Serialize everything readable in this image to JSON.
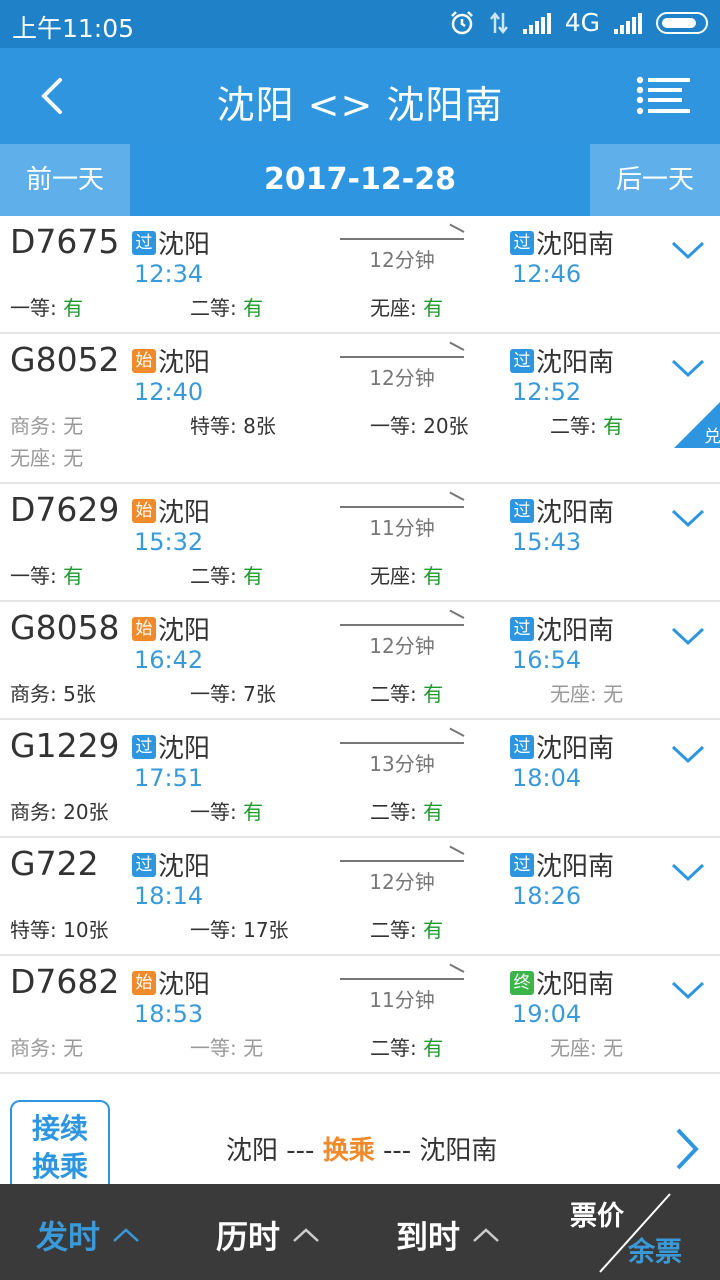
{
  "status": {
    "time": "上午11:05",
    "network": "4G"
  },
  "nav": {
    "title": "沈阳 <> 沈阳南"
  },
  "datebar": {
    "prev": "前一天",
    "date": "2017-12-28",
    "next": "后一天"
  },
  "trains": [
    {
      "no": "D7675",
      "from_tag": "过",
      "from_tag_type": "pass",
      "from": "沈阳",
      "dep": "12:34",
      "duration": "12分钟",
      "to_tag": "过",
      "to_tag_type": "pass",
      "to": "沈阳南",
      "arr": "12:46",
      "seat_rows": [
        [
          {
            "label": "一等: ",
            "value": "有",
            "green": true
          },
          {
            "label": "二等: ",
            "value": "有",
            "green": true
          },
          {
            "label": "无座: ",
            "value": "有",
            "green": true
          }
        ]
      ]
    },
    {
      "no": "G8052",
      "from_tag": "始",
      "from_tag_type": "start",
      "from": "沈阳",
      "dep": "12:40",
      "duration": "12分钟",
      "to_tag": "过",
      "to_tag_type": "pass",
      "to": "沈阳南",
      "arr": "12:52",
      "corner": "兑",
      "seat_rows": [
        [
          {
            "label": "商务: ",
            "value": "无",
            "muted": true
          },
          {
            "label": "特等: ",
            "value": "8张"
          },
          {
            "label": "一等: ",
            "value": "20张"
          },
          {
            "label": "二等: ",
            "value": "有",
            "green": true
          }
        ],
        [
          {
            "label": "无座: ",
            "value": "无",
            "muted": true
          }
        ]
      ]
    },
    {
      "no": "D7629",
      "from_tag": "始",
      "from_tag_type": "start",
      "from": "沈阳",
      "dep": "15:32",
      "duration": "11分钟",
      "to_tag": "过",
      "to_tag_type": "pass",
      "to": "沈阳南",
      "arr": "15:43",
      "seat_rows": [
        [
          {
            "label": "一等: ",
            "value": "有",
            "green": true
          },
          {
            "label": "二等: ",
            "value": "有",
            "green": true
          },
          {
            "label": "无座: ",
            "value": "有",
            "green": true
          }
        ]
      ]
    },
    {
      "no": "G8058",
      "from_tag": "始",
      "from_tag_type": "start",
      "from": "沈阳",
      "dep": "16:42",
      "duration": "12分钟",
      "to_tag": "过",
      "to_tag_type": "pass",
      "to": "沈阳南",
      "arr": "16:54",
      "seat_rows": [
        [
          {
            "label": "商务: ",
            "value": "5张"
          },
          {
            "label": "一等: ",
            "value": "7张"
          },
          {
            "label": "二等: ",
            "value": "有",
            "green": true
          },
          {
            "label": "无座: ",
            "value": "无",
            "muted": true
          }
        ]
      ]
    },
    {
      "no": "G1229",
      "from_tag": "过",
      "from_tag_type": "pass",
      "from": "沈阳",
      "dep": "17:51",
      "duration": "13分钟",
      "to_tag": "过",
      "to_tag_type": "pass",
      "to": "沈阳南",
      "arr": "18:04",
      "seat_rows": [
        [
          {
            "label": "商务: ",
            "value": "20张"
          },
          {
            "label": "一等: ",
            "value": "有",
            "green": true
          },
          {
            "label": "二等: ",
            "value": "有",
            "green": true
          }
        ]
      ]
    },
    {
      "no": "G722",
      "from_tag": "过",
      "from_tag_type": "pass",
      "from": "沈阳",
      "dep": "18:14",
      "duration": "12分钟",
      "to_tag": "过",
      "to_tag_type": "pass",
      "to": "沈阳南",
      "arr": "18:26",
      "seat_rows": [
        [
          {
            "label": "特等: ",
            "value": "10张"
          },
          {
            "label": "一等: ",
            "value": "17张"
          },
          {
            "label": "二等: ",
            "value": "有",
            "green": true
          }
        ]
      ]
    },
    {
      "no": "D7682",
      "from_tag": "始",
      "from_tag_type": "start",
      "from": "沈阳",
      "dep": "18:53",
      "duration": "11分钟",
      "to_tag": "终",
      "to_tag_type": "end",
      "to": "沈阳南",
      "arr": "19:04",
      "seat_rows": [
        [
          {
            "label": "商务: ",
            "value": "无",
            "muted": true
          },
          {
            "label": "一等: ",
            "value": "无",
            "muted": true
          },
          {
            "label": "二等: ",
            "value": "有",
            "green": true
          },
          {
            "label": "无座: ",
            "value": "无",
            "muted": true
          }
        ]
      ]
    }
  ],
  "transfer": {
    "badge_line1": "接续",
    "badge_line2": "换乘",
    "from": "沈阳 --- ",
    "mid": "换乘",
    "to": " --- 沈阳南"
  },
  "bottom": {
    "sort_dep": "发时",
    "sort_dur": "历时",
    "sort_arr": "到时",
    "price": "票价",
    "tickets": "余票"
  },
  "colors": {
    "primary": "#2f95df",
    "accent": "#3a9ad9",
    "available": "#1a9a2a",
    "start_tag": "#f08a2a",
    "end_tag": "#3bb44a"
  }
}
